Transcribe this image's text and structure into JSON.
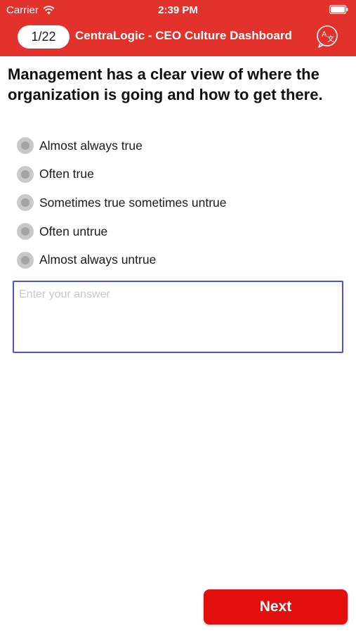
{
  "status_bar": {
    "carrier": "Carrier",
    "time": "2:39 PM",
    "wifi_icon": "wifi-icon",
    "battery_icon": "battery-icon"
  },
  "nav": {
    "progress": "1/22",
    "title": "CentraLogic - CEO Culture Dashboard",
    "translate_icon": "translate-icon"
  },
  "question": {
    "text": "Management has a clear view of where the organization is going and how to get there.",
    "options": [
      "Almost always true",
      "Often true",
      "Sometimes true sometimes untrue",
      "Often untrue",
      "Almost always untrue"
    ]
  },
  "answer": {
    "placeholder": "Enter your answer",
    "value": ""
  },
  "footer": {
    "next_label": "Next"
  },
  "colors": {
    "header_bg": "#e3312b",
    "next_button_bg": "#e30e0e",
    "input_border": "#4a52d9"
  }
}
